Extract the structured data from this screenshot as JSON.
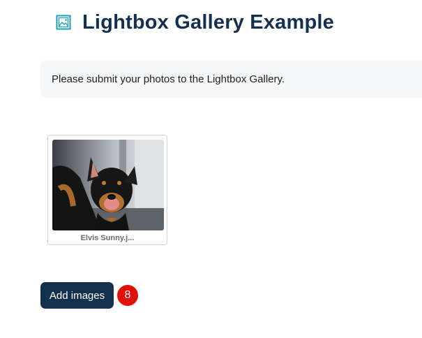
{
  "header": {
    "title": "Lightbox Gallery Example",
    "icon": "image-icon",
    "icon_color": "#1aa0b5",
    "title_color": "#14304f"
  },
  "notice": {
    "text": "Please submit your photos to the Lightbox Gallery."
  },
  "gallery": {
    "items": [
      {
        "caption": "Elvis Sunny.j..."
      }
    ]
  },
  "actions": {
    "add_images_label": "Add images",
    "count_badge": "8",
    "badge_color": "#e0100a",
    "button_color": "#14304f"
  }
}
